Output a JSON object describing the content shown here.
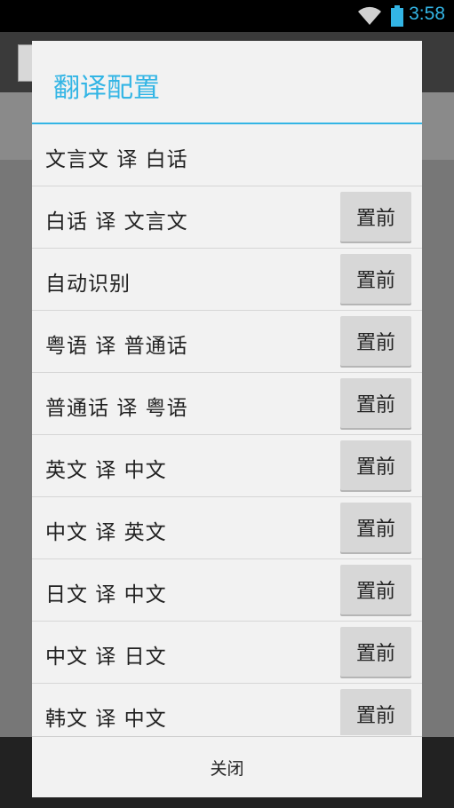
{
  "status_bar": {
    "time": "3:58",
    "icons": [
      "wifi-icon",
      "battery-icon"
    ],
    "accent": "#33b5e5"
  },
  "dialog": {
    "title": "翻译配置",
    "close_label": "关闭",
    "items": [
      {
        "label": "文言文 译 白话",
        "button": ""
      },
      {
        "label": "白话 译 文言文",
        "button": "置前"
      },
      {
        "label": "自动识别",
        "button": "置前"
      },
      {
        "label": "粤语 译 普通话",
        "button": "置前"
      },
      {
        "label": "普通话 译 粤语",
        "button": "置前"
      },
      {
        "label": "英文 译 中文",
        "button": "置前"
      },
      {
        "label": "中文 译 英文",
        "button": "置前"
      },
      {
        "label": "日文 译 中文",
        "button": "置前"
      },
      {
        "label": "中文 译 日文",
        "button": "置前"
      },
      {
        "label": "韩文 译 中文",
        "button": "置前"
      }
    ]
  }
}
